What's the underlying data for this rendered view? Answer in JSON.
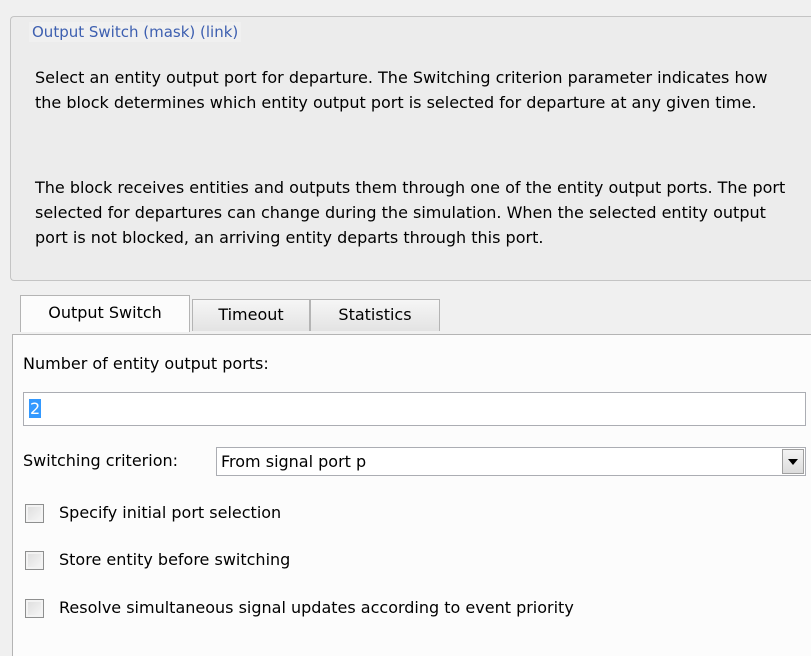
{
  "mask": {
    "title": "Output Switch (mask) (link)",
    "description_1": "Select an entity output port for departure. The Switching criterion parameter indicates how the block determines which entity output port is selected for departure at any given time.",
    "description_2": "The block receives entities and outputs them through one of the entity output ports. The port selected for departures can change during the simulation. When the selected entity output port is not blocked, an arriving entity departs through this port."
  },
  "tabs": [
    {
      "label": "Output Switch",
      "active": true
    },
    {
      "label": "Timeout",
      "active": false
    },
    {
      "label": "Statistics",
      "active": false
    }
  ],
  "params": {
    "num_ports_label": "Number of entity output ports:",
    "num_ports_value": "2",
    "switching_label": "Switching criterion:",
    "switching_value": "From signal port p",
    "checkboxes": [
      {
        "label": "Specify initial port selection",
        "checked": false
      },
      {
        "label": "Store entity before switching",
        "checked": false
      },
      {
        "label": "Resolve simultaneous signal updates according to event priority",
        "checked": false
      }
    ]
  },
  "colors": {
    "group_title": "#3d5fb0",
    "selection": "#3399ff"
  }
}
